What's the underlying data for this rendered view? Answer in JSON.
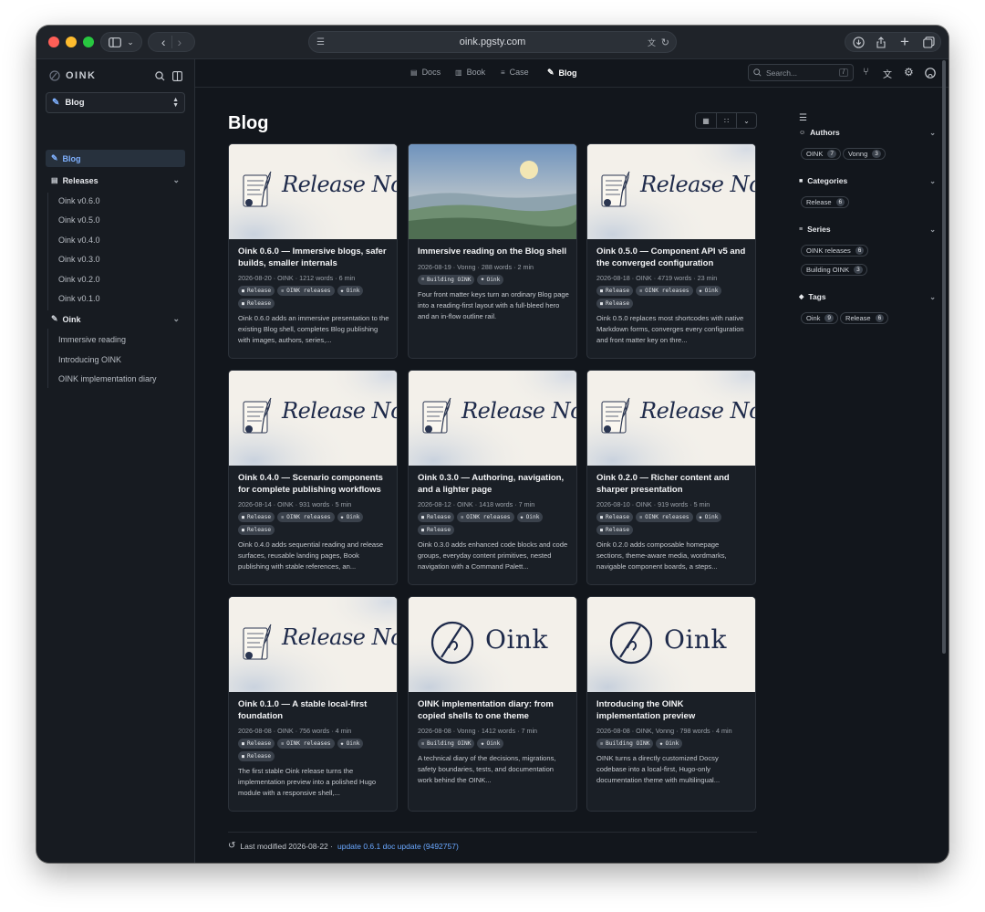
{
  "browser": {
    "url": "oink.pgsty.com"
  },
  "sidebar": {
    "brand": "OINK",
    "section_select": "Blog",
    "items": [
      {
        "label": "Blog",
        "type": "active"
      },
      {
        "label": "Releases",
        "type": "group"
      },
      {
        "label": "Oink v0.6.0",
        "type": "child"
      },
      {
        "label": "Oink v0.5.0",
        "type": "child"
      },
      {
        "label": "Oink v0.4.0",
        "type": "child"
      },
      {
        "label": "Oink v0.3.0",
        "type": "child"
      },
      {
        "label": "Oink v0.2.0",
        "type": "child"
      },
      {
        "label": "Oink v0.1.0",
        "type": "child"
      },
      {
        "label": "Oink",
        "type": "group"
      },
      {
        "label": "Immersive reading",
        "type": "child"
      },
      {
        "label": "Introducing OINK",
        "type": "child"
      },
      {
        "label": "OINK implementation diary",
        "type": "child"
      }
    ]
  },
  "topnav": {
    "links": [
      "Docs",
      "Book",
      "Case",
      "Blog"
    ],
    "search_placeholder": "Search...",
    "search_shortcut": "/"
  },
  "main": {
    "title": "Blog",
    "cards": [
      {
        "title": "Oink 0.6.0 — Immersive blogs, safer builds, smaller internals",
        "meta": "2026-08-20 · OINK · 1212 words · 6 min",
        "tags": [
          "Release",
          "OINK releases",
          "Oink",
          "Release"
        ],
        "summary": "Oink 0.6.0 adds an immersive presentation to the existing Blog shell, completes Blog publishing with images, authors, series,...",
        "image": "release-note",
        "image_text": "Release Note"
      },
      {
        "title": "Immersive reading on the Blog shell",
        "meta": "2026-08-19 · Vonng · 288 words · 2 min",
        "tags": [
          "Building OINK",
          "Oink"
        ],
        "summary": "Four front matter keys turn an ordinary Blog page into a reading-first layout with a full-bleed hero and an in-flow outline rail.",
        "image": "landscape",
        "image_text": ""
      },
      {
        "title": "Oink 0.5.0 — Component API v5 and the converged configuration",
        "meta": "2026-08-18 · OINK · 4719 words · 23 min",
        "tags": [
          "Release",
          "OINK releases",
          "Oink",
          "Release"
        ],
        "summary": "Oink 0.5.0 replaces most shortcodes with native Markdown forms, converges every configuration and front matter key on thre...",
        "image": "release-note",
        "image_text": "Release Note"
      },
      {
        "title": "Oink 0.4.0 — Scenario components for complete publishing workflows",
        "meta": "2026-08-14 · OINK · 931 words · 5 min",
        "tags": [
          "Release",
          "OINK releases",
          "Oink",
          "Release"
        ],
        "summary": "Oink 0.4.0 adds sequential reading and release surfaces, reusable landing pages, Book publishing with stable references, an...",
        "image": "release-note",
        "image_text": "Release Note"
      },
      {
        "title": "Oink 0.3.0 — Authoring, navigation, and a lighter page",
        "meta": "2026-08-12 · OINK · 1418 words · 7 min",
        "tags": [
          "Release",
          "OINK releases",
          "Oink",
          "Release"
        ],
        "summary": "Oink 0.3.0 adds enhanced code blocks and code groups, everyday content primitives, nested navigation with a Command Palett...",
        "image": "release-note",
        "image_text": "Release Note"
      },
      {
        "title": "Oink 0.2.0 — Richer content and sharper presentation",
        "meta": "2026-08-10 · OINK · 919 words · 5 min",
        "tags": [
          "Release",
          "OINK releases",
          "Oink",
          "Release"
        ],
        "summary": "Oink 0.2.0 adds composable homepage sections, theme-aware media, wordmarks, navigable component boards, a steps...",
        "image": "release-note",
        "image_text": "Release Note"
      },
      {
        "title": "Oink 0.1.0 — A stable local-first foundation",
        "meta": "2026-08-08 · OINK · 756 words · 4 min",
        "tags": [
          "Release",
          "OINK releases",
          "Oink",
          "Release"
        ],
        "summary": "The first stable Oink release turns the implementation preview into a polished Hugo module with a responsive shell,...",
        "image": "release-note",
        "image_text": "Release Note"
      },
      {
        "title": "OINK implementation diary: from copied shells to one theme",
        "meta": "2026-08-08 · Vonng · 1412 words · 7 min",
        "tags": [
          "Building OINK",
          "Oink"
        ],
        "summary": "A technical diary of the decisions, migrations, safety boundaries, tests, and documentation work behind the OINK...",
        "image": "oink-logo",
        "image_text": "Oink"
      },
      {
        "title": "Introducing the OINK implementation preview",
        "meta": "2026-08-08 · OINK, Vonng · 798 words · 4 min",
        "tags": [
          "Building OINK",
          "Oink"
        ],
        "summary": "OINK turns a directly customized Docsy codebase into a local-first, Hugo-only documentation theme with multilingual...",
        "image": "oink-logo",
        "image_text": "Oink"
      }
    ],
    "footer": {
      "prefix": "Last modified 2026-08-22 ·",
      "link": "update 0.6.1 doc update (9492757)"
    }
  },
  "right_panel": {
    "sections": [
      {
        "title": "Authors",
        "icon": "author-icon",
        "items": [
          {
            "label": "OINK",
            "count": "7"
          },
          {
            "label": "Vonng",
            "count": "3"
          }
        ]
      },
      {
        "title": "Categories",
        "icon": "folder-icon",
        "items": [
          {
            "label": "Release",
            "count": "6"
          }
        ]
      },
      {
        "title": "Series",
        "icon": "stack-icon",
        "items": [
          {
            "label": "OINK releases",
            "count": "6"
          },
          {
            "label": "Building OINK",
            "count": "3"
          }
        ]
      },
      {
        "title": "Tags",
        "icon": "tag-icon",
        "items": [
          {
            "label": "Oink",
            "count": "9"
          },
          {
            "label": "Release",
            "count": "6"
          }
        ]
      }
    ]
  },
  "colors": {
    "accent": "#7fb1ff",
    "link": "#6aa8ff",
    "background": "#12161c"
  }
}
